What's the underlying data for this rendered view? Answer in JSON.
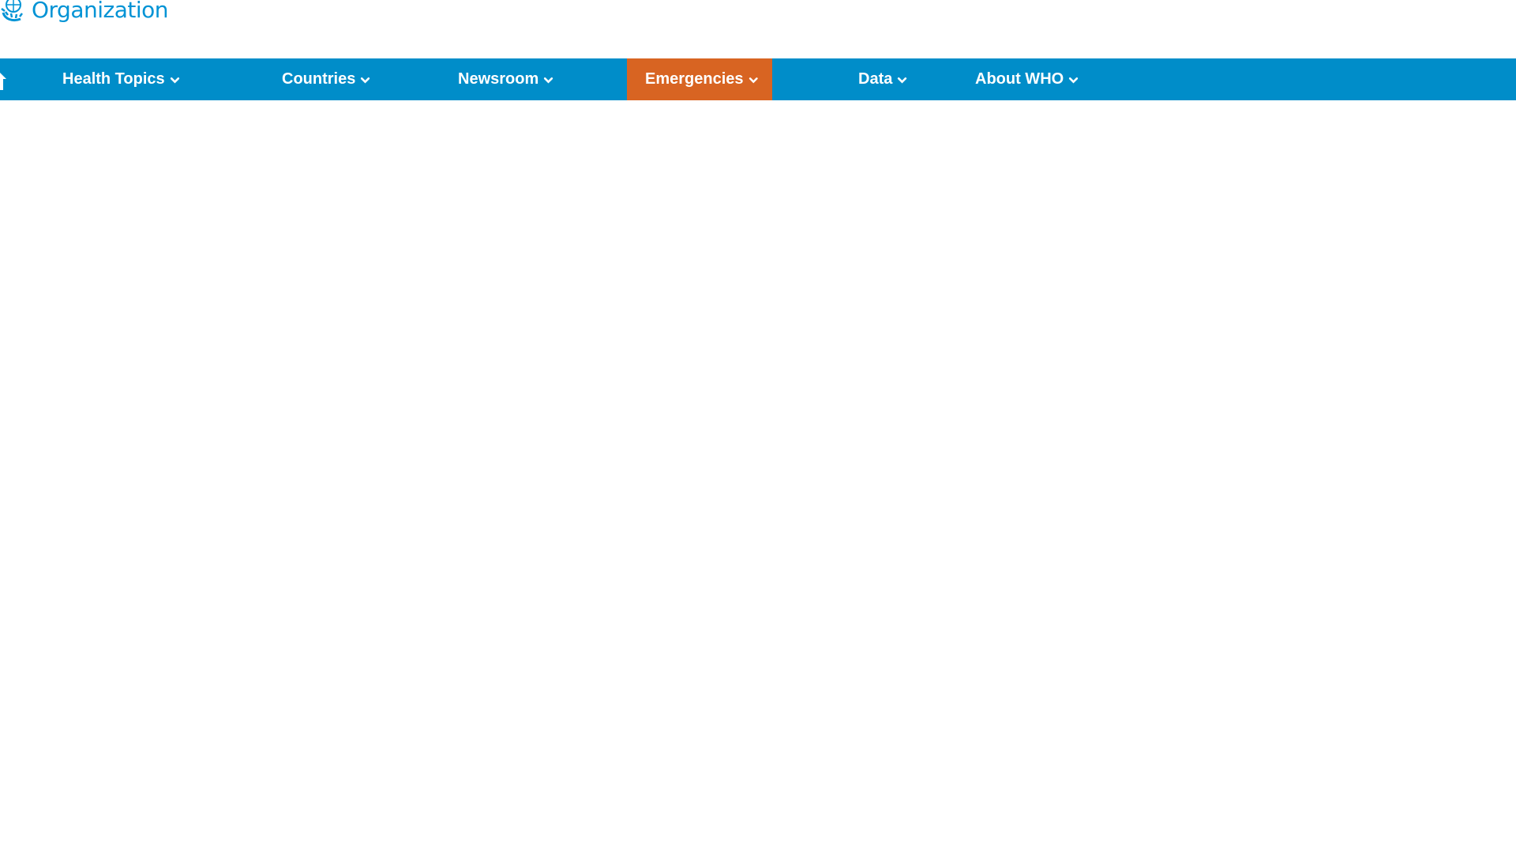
{
  "header": {
    "logo_text": "Organization",
    "logo_icon": "who-emblem-icon"
  },
  "nav": {
    "home_icon": "home-icon",
    "items": [
      {
        "label": "Health Topics",
        "icon": "chevron-down-icon",
        "active": false
      },
      {
        "label": "Countries",
        "icon": "chevron-down-icon",
        "active": false
      },
      {
        "label": "Newsroom",
        "icon": "chevron-down-icon",
        "active": false
      },
      {
        "label": "Emergencies",
        "icon": "chevron-down-icon",
        "active": true
      },
      {
        "label": "Data",
        "icon": "chevron-down-icon",
        "active": false
      },
      {
        "label": "About WHO",
        "icon": "chevron-down-icon",
        "active": false
      }
    ]
  },
  "colors": {
    "brand_blue": "#008dc9",
    "logo_blue": "#0093d5",
    "active_orange": "#d86422",
    "background": "#ffffff"
  }
}
